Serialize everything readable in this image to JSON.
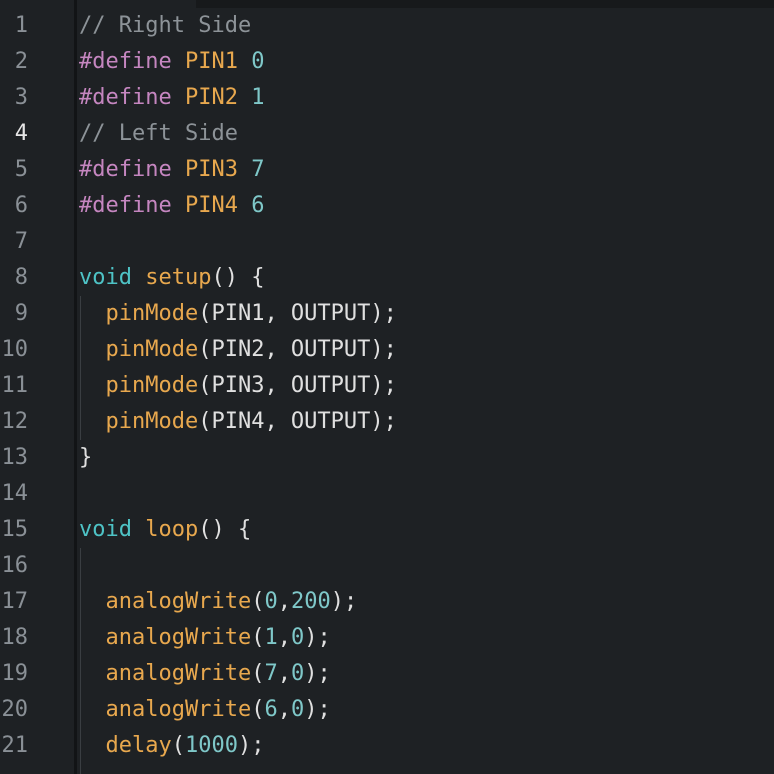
{
  "editor": {
    "colors": {
      "background": "#1e2124",
      "line_number": "#8a9096",
      "line_number_active": "#e6e6e6",
      "comment": "#8d9398",
      "preprocessor": "#c586c0",
      "macro": "#e8a84e",
      "number": "#7fc8c9",
      "keyword": "#4ec3c6",
      "function": "#e8a84e",
      "text": "#e0e0e0"
    },
    "active_line": "4",
    "lines": [
      {
        "n": "1",
        "tokens": [
          {
            "t": "comment",
            "v": "// Right Side"
          }
        ]
      },
      {
        "n": "2",
        "tokens": [
          {
            "t": "pre",
            "v": "#define"
          },
          {
            "t": "plain",
            "v": " "
          },
          {
            "t": "macro",
            "v": "PIN1"
          },
          {
            "t": "plain",
            "v": " "
          },
          {
            "t": "num",
            "v": "0"
          }
        ]
      },
      {
        "n": "3",
        "tokens": [
          {
            "t": "pre",
            "v": "#define"
          },
          {
            "t": "plain",
            "v": " "
          },
          {
            "t": "macro",
            "v": "PIN2"
          },
          {
            "t": "plain",
            "v": " "
          },
          {
            "t": "num",
            "v": "1"
          }
        ]
      },
      {
        "n": "4",
        "tokens": [
          {
            "t": "comment",
            "v": "// Left Side"
          }
        ]
      },
      {
        "n": "5",
        "tokens": [
          {
            "t": "pre",
            "v": "#define"
          },
          {
            "t": "plain",
            "v": " "
          },
          {
            "t": "macro",
            "v": "PIN3"
          },
          {
            "t": "plain",
            "v": " "
          },
          {
            "t": "num",
            "v": "7"
          }
        ]
      },
      {
        "n": "6",
        "tokens": [
          {
            "t": "pre",
            "v": "#define"
          },
          {
            "t": "plain",
            "v": " "
          },
          {
            "t": "macro",
            "v": "PIN4"
          },
          {
            "t": "plain",
            "v": " "
          },
          {
            "t": "num",
            "v": "6"
          }
        ]
      },
      {
        "n": "7",
        "tokens": []
      },
      {
        "n": "8",
        "tokens": [
          {
            "t": "kw",
            "v": "void"
          },
          {
            "t": "plain",
            "v": " "
          },
          {
            "t": "fn",
            "v": "setup"
          },
          {
            "t": "plain",
            "v": "() {"
          }
        ]
      },
      {
        "n": "9",
        "tokens": [
          {
            "t": "plain",
            "v": "  "
          },
          {
            "t": "fn",
            "v": "pinMode"
          },
          {
            "t": "plain",
            "v": "(PIN1, OUTPUT);"
          }
        ]
      },
      {
        "n": "10",
        "tokens": [
          {
            "t": "plain",
            "v": "  "
          },
          {
            "t": "fn",
            "v": "pinMode"
          },
          {
            "t": "plain",
            "v": "(PIN2, OUTPUT);"
          }
        ]
      },
      {
        "n": "11",
        "tokens": [
          {
            "t": "plain",
            "v": "  "
          },
          {
            "t": "fn",
            "v": "pinMode"
          },
          {
            "t": "plain",
            "v": "(PIN3, OUTPUT);"
          }
        ]
      },
      {
        "n": "12",
        "tokens": [
          {
            "t": "plain",
            "v": "  "
          },
          {
            "t": "fn",
            "v": "pinMode"
          },
          {
            "t": "plain",
            "v": "(PIN4, OUTPUT);"
          }
        ]
      },
      {
        "n": "13",
        "tokens": [
          {
            "t": "plain",
            "v": "}"
          }
        ]
      },
      {
        "n": "14",
        "tokens": []
      },
      {
        "n": "15",
        "tokens": [
          {
            "t": "kw",
            "v": "void"
          },
          {
            "t": "plain",
            "v": " "
          },
          {
            "t": "fn",
            "v": "loop"
          },
          {
            "t": "plain",
            "v": "() {"
          }
        ]
      },
      {
        "n": "16",
        "tokens": []
      },
      {
        "n": "17",
        "tokens": [
          {
            "t": "plain",
            "v": "  "
          },
          {
            "t": "fn",
            "v": "analogWrite"
          },
          {
            "t": "plain",
            "v": "("
          },
          {
            "t": "num",
            "v": "0"
          },
          {
            "t": "plain",
            "v": ","
          },
          {
            "t": "num",
            "v": "200"
          },
          {
            "t": "plain",
            "v": ");"
          }
        ]
      },
      {
        "n": "18",
        "tokens": [
          {
            "t": "plain",
            "v": "  "
          },
          {
            "t": "fn",
            "v": "analogWrite"
          },
          {
            "t": "plain",
            "v": "("
          },
          {
            "t": "num",
            "v": "1"
          },
          {
            "t": "plain",
            "v": ","
          },
          {
            "t": "num",
            "v": "0"
          },
          {
            "t": "plain",
            "v": ");"
          }
        ]
      },
      {
        "n": "19",
        "tokens": [
          {
            "t": "plain",
            "v": "  "
          },
          {
            "t": "fn",
            "v": "analogWrite"
          },
          {
            "t": "plain",
            "v": "("
          },
          {
            "t": "num",
            "v": "7"
          },
          {
            "t": "plain",
            "v": ","
          },
          {
            "t": "num",
            "v": "0"
          },
          {
            "t": "plain",
            "v": ");"
          }
        ]
      },
      {
        "n": "20",
        "tokens": [
          {
            "t": "plain",
            "v": "  "
          },
          {
            "t": "fn",
            "v": "analogWrite"
          },
          {
            "t": "plain",
            "v": "("
          },
          {
            "t": "num",
            "v": "6"
          },
          {
            "t": "plain",
            "v": ","
          },
          {
            "t": "num",
            "v": "0"
          },
          {
            "t": "plain",
            "v": ");"
          }
        ]
      },
      {
        "n": "21",
        "tokens": [
          {
            "t": "plain",
            "v": "  "
          },
          {
            "t": "fn",
            "v": "delay"
          },
          {
            "t": "plain",
            "v": "("
          },
          {
            "t": "num",
            "v": "1000"
          },
          {
            "t": "plain",
            "v": ");"
          }
        ]
      }
    ]
  }
}
